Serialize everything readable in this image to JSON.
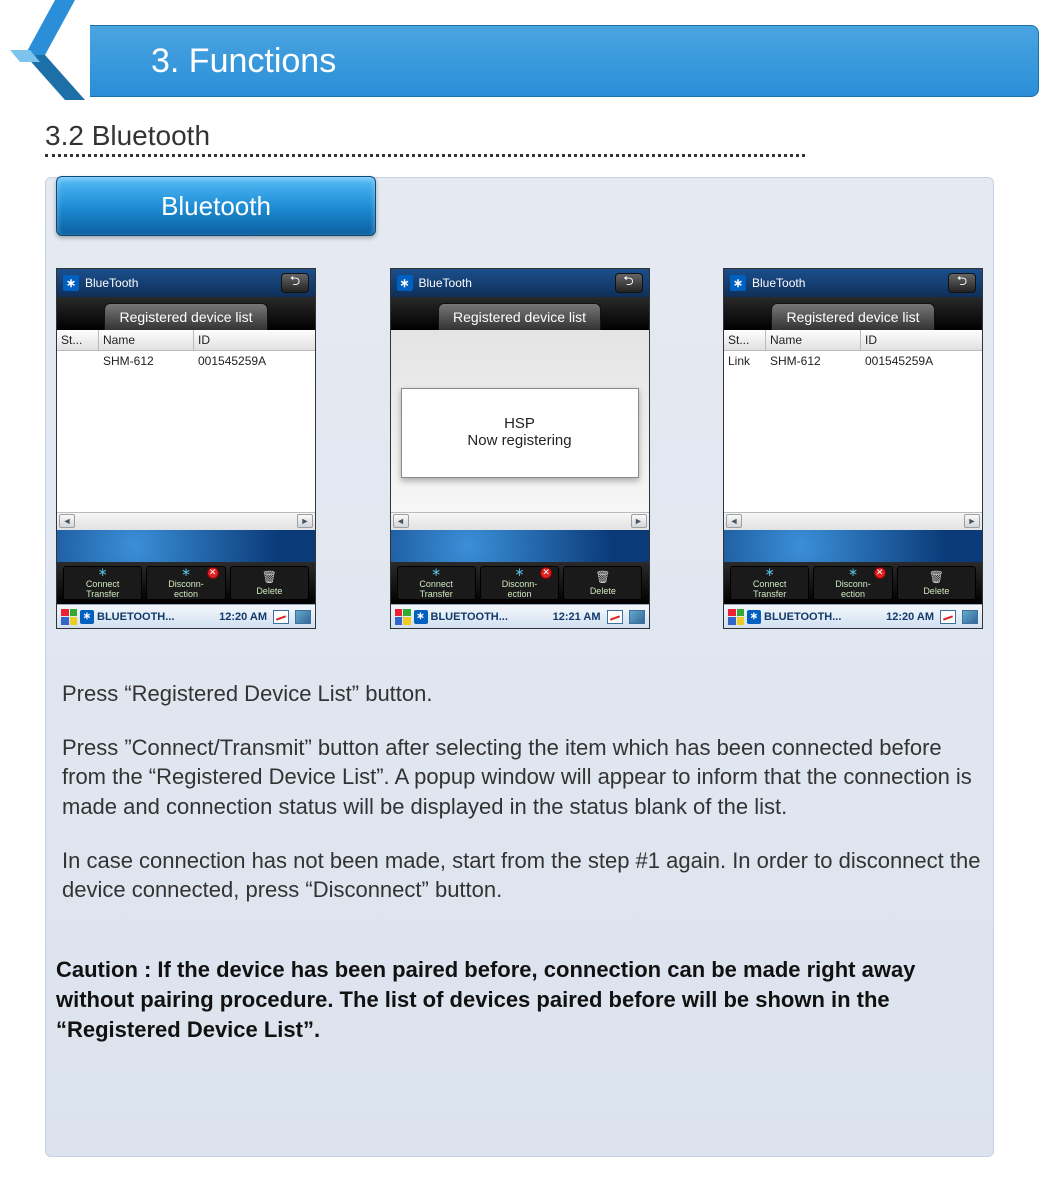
{
  "header": {
    "title": "3. Functions"
  },
  "section": {
    "title": "3.2 Bluetooth"
  },
  "tab": {
    "label": "Bluetooth"
  },
  "device_common": {
    "title": "BlueTooth",
    "reg_tab": "Registered device list",
    "columns": {
      "st": "St...",
      "name": "Name",
      "id": "ID"
    },
    "toolbar": {
      "connect": "Connect\nTransfer",
      "disconnect": "Disconn-\nection",
      "delete": "Delete"
    },
    "taskbar": {
      "label": "BLUETOOTH..."
    }
  },
  "screens": [
    {
      "rows": [
        {
          "st": "",
          "name": "SHM-612",
          "id": "001545259A"
        }
      ],
      "time": "12:20 AM",
      "popup": null
    },
    {
      "rows": [],
      "time": "12:21 AM",
      "popup": {
        "line1": "HSP",
        "line2": "Now registering"
      }
    },
    {
      "rows": [
        {
          "st": "Link",
          "name": "SHM-612",
          "id": "001545259A"
        }
      ],
      "time": "12:20 AM",
      "popup": null
    }
  ],
  "instructions": {
    "p1": "Press “Registered Device List” button.",
    "p2": "Press ”Connect/Transmit” button after selecting the item which has been connected before from the “Registered Device List”. A popup window will appear to inform that the connection is made and connection status will be displayed in the status blank of the list.",
    "p3": "In case connection has not been made, start from the step #1 again. In order to disconnect the device connected, press “Disconnect” button.",
    "caution": "Caution : If the device has been paired before, connection can be made right away without pairing procedure. The list of devices paired before will be shown in the “Registered Device List”."
  }
}
